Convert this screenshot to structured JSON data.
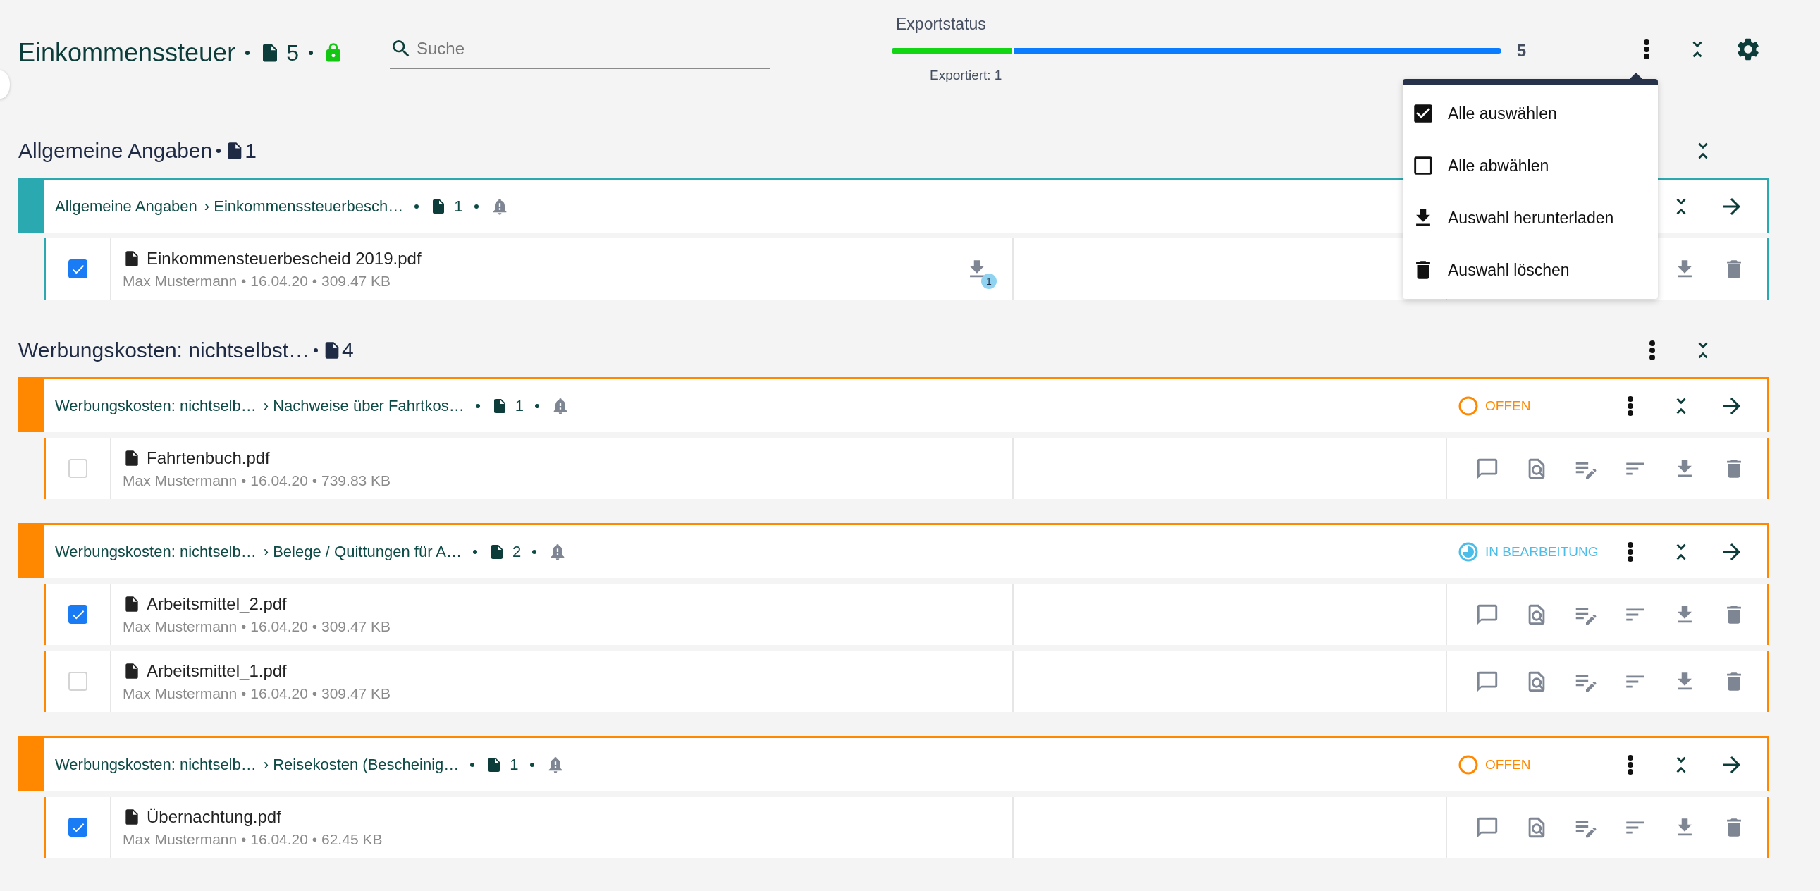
{
  "header": {
    "title": "Einkommenssteuer",
    "count": "5",
    "locked": true,
    "search": {
      "placeholder": "Suche"
    },
    "export": {
      "label": "Exportstatus",
      "level": 0.2,
      "exported": "Exportiert: 1",
      "total": "5"
    }
  },
  "menu": {
    "open": true,
    "items": [
      {
        "kind": "select_all",
        "label": "Alle auswählen"
      },
      {
        "kind": "deselect_all",
        "label": "Alle abwählen"
      },
      {
        "kind": "download",
        "label": "Auswahl herunterladen"
      },
      {
        "kind": "delete",
        "label": "Auswahl löschen"
      }
    ]
  },
  "sections": [
    {
      "title": "Allgemeine Angaben",
      "count": "1",
      "has_menu": false,
      "groups": [
        {
          "color": "#2aa9b1",
          "path": [
            "Allgemeine Angaben",
            "› Einkommenssteuerbesch…"
          ],
          "count": "1",
          "has_menu": false,
          "files": [
            {
              "name": "Einkommensteuerbescheid 2019.pdf",
              "meta": "Max Mustermann • 16.04.20 • 309.47 KB",
              "checked": true,
              "kind": "compact",
              "downloads": "1"
            }
          ]
        }
      ]
    },
    {
      "title": "Werbungskosten: nichtselbst…",
      "count": "4",
      "has_menu": true,
      "groups": [
        {
          "color": "#ff8800",
          "path": [
            "Werbungskosten: nichtselb…",
            "› Nachweise über Fahrtkos…"
          ],
          "count": "1",
          "has_menu": true,
          "status": {
            "kind": "open",
            "label": "OFFEN"
          },
          "files": [
            {
              "name": "Fahrtenbuch.pdf",
              "meta": "Max Mustermann • 16.04.20 • 739.83 KB",
              "checked": false,
              "kind": "full"
            }
          ]
        },
        {
          "color": "#ff8800",
          "path": [
            "Werbungskosten: nichtselb…",
            "› Belege / Quittungen für A…"
          ],
          "count": "2",
          "has_menu": true,
          "status": {
            "kind": "in_progress",
            "label": "IN BEARBEITUNG"
          },
          "files": [
            {
              "name": "Arbeitsmittel_2.pdf",
              "meta": "Max Mustermann • 16.04.20 • 309.47 KB",
              "checked": true,
              "kind": "full"
            },
            {
              "name": "Arbeitsmittel_1.pdf",
              "meta": "Max Mustermann • 16.04.20 • 309.47 KB",
              "checked": false,
              "kind": "full"
            }
          ]
        },
        {
          "color": "#ff8800",
          "path": [
            "Werbungskosten: nichtselb…",
            "› Reisekosten (Bescheinig…"
          ],
          "count": "1",
          "has_menu": true,
          "status": {
            "kind": "open",
            "label": "OFFEN"
          },
          "files": [
            {
              "name": "Übernachtung.pdf",
              "meta": "Max Mustermann • 16.04.20 • 62.45 KB",
              "checked": true,
              "kind": "full"
            }
          ]
        }
      ]
    }
  ]
}
